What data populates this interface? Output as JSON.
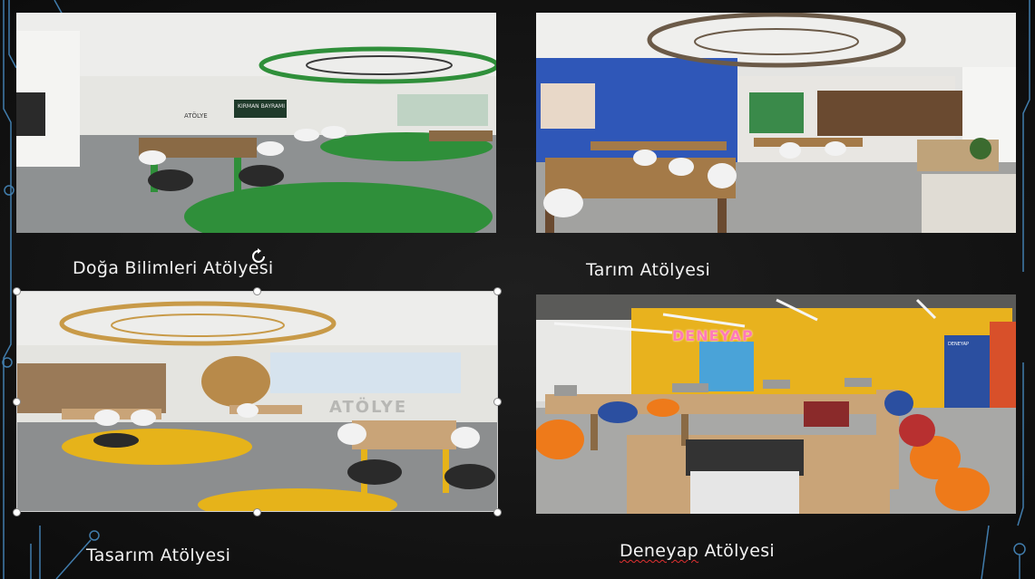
{
  "slide": {
    "panels": [
      {
        "id": "doga",
        "caption": "Doğa Bilimleri Atölyesi",
        "floor_accent": "#2f8f3a",
        "wall_accent": "#e8e8e4"
      },
      {
        "id": "tarim",
        "caption": "Tarım Atölyesi",
        "floor_accent": "#7d7d7d",
        "wall_accent": "#2f57b8"
      },
      {
        "id": "tasarim",
        "caption": "Tasarım Atölyesi",
        "floor_accent": "#e6b31a",
        "wall_accent": "#dcdcd8"
      },
      {
        "id": "deneyap",
        "caption_underlined": "Deneyap",
        "caption_rest": " Atölyesi",
        "floor_accent": "#9a9a9a",
        "wall_accent": "#e8b21e"
      }
    ],
    "photo_texts": {
      "doga_wall": "ATÖLYE",
      "doga_sign": "KIRMAN BAYRAMI",
      "tasarim_wall": "ATÖLYE",
      "deneyap_logo": "DENEYAP",
      "deneyap_banner": "DENEYAP"
    }
  },
  "colors": {
    "background": "#131313",
    "circuit": "#4a90c8",
    "caption": "#f2f2f2",
    "spellcheck": "#e03030"
  },
  "icons": {
    "rotate": "rotate-handle-icon",
    "circuit": "circuit-board-decoration"
  }
}
